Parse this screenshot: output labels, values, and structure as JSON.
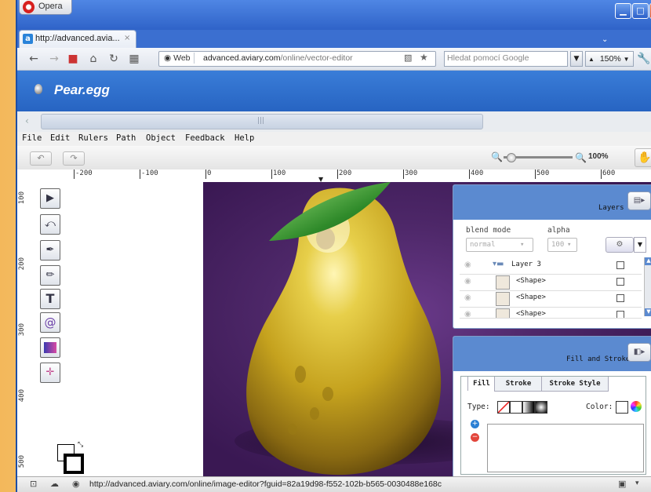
{
  "browser": {
    "opera_label": "Opera",
    "tab_title": "http://advanced.avia...",
    "tab_close": "×",
    "web_badge": "Web",
    "url_host": "advanced.aviary.com",
    "url_path": "/online/vector-editor",
    "search_placeholder": "Hledat pomocí Google",
    "zoom": "150%",
    "status_url": "http://advanced.aviary.com/online/image-editor?fguid=82a19d98-f552-102b-b565-0030488e168c"
  },
  "app": {
    "title": "Pear.egg",
    "menu": [
      "File",
      "Edit",
      "Rulers",
      "Path",
      "Object",
      "Feedback",
      "Help"
    ],
    "zoom_level": "100%"
  },
  "rulers": {
    "h_labels": [
      "-200",
      "-100",
      "0",
      "100",
      "200",
      "300",
      "400",
      "500",
      "600"
    ],
    "v_labels": [
      "100",
      "200",
      "300",
      "400",
      "500"
    ]
  },
  "tools": [
    {
      "name": "select-tool-icon",
      "glyph": "▶"
    },
    {
      "name": "node-tool-icon",
      "glyph": "⤺"
    },
    {
      "name": "pen-tool-icon",
      "glyph": "✒"
    },
    {
      "name": "pencil-tool-icon",
      "glyph": "✏"
    },
    {
      "name": "text-tool-icon",
      "glyph": "T"
    },
    {
      "name": "spiral-tool-icon",
      "glyph": "@"
    },
    {
      "name": "gradient-tool-icon",
      "glyph": ""
    },
    {
      "name": "transform-tool-icon",
      "glyph": "✛"
    }
  ],
  "layers_panel": {
    "title": "Layers",
    "blend_mode_label": "blend mode",
    "alpha_label": "alpha",
    "blend_mode_value": "normal",
    "alpha_value": "100",
    "rows": [
      {
        "name": "Layer 3",
        "type": "folder"
      },
      {
        "name": "<Shape>",
        "type": "shape"
      },
      {
        "name": "<Shape>",
        "type": "shape"
      },
      {
        "name": "<Shape>",
        "type": "shape"
      }
    ]
  },
  "fill_panel": {
    "title": "Fill and Stroke",
    "tabs": [
      "Fill",
      "Stroke",
      "Stroke Style"
    ],
    "type_label": "Type:",
    "color_label": "Color:"
  },
  "colors": {
    "brand_blue": "#2764c2",
    "canvas_purple": "#4d2768",
    "pear_yellow": "#c9a51f"
  }
}
